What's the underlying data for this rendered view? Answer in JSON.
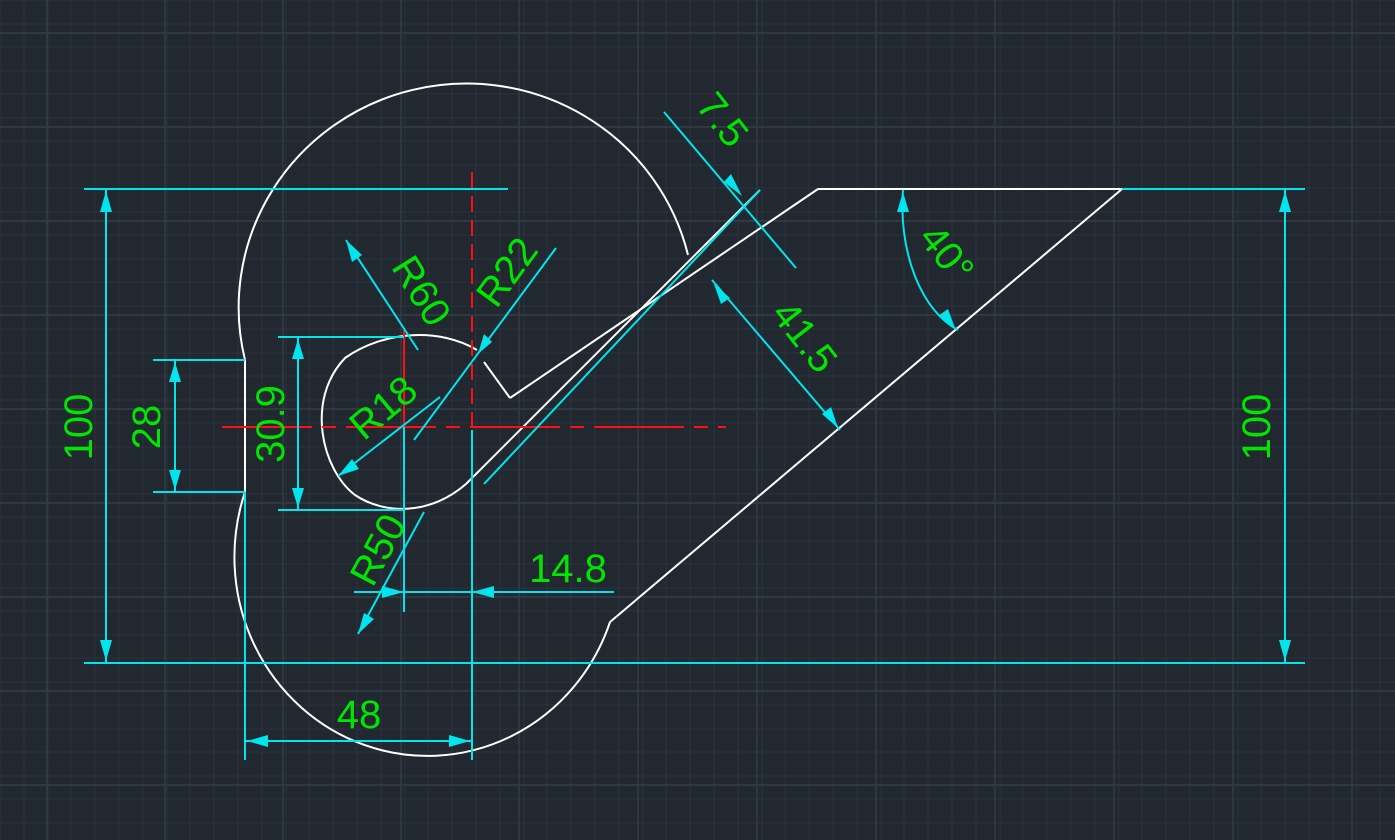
{
  "drawing": {
    "colors": {
      "background": "#212830",
      "geometry": "#ffffff",
      "dimension": "#00e5ee",
      "dimension_text": "#00e600",
      "centerline": "#ff1010"
    },
    "dimensions": {
      "overall_height_left": "100",
      "overall_height_right": "100",
      "flat_height": "28",
      "inner_height": "30.9",
      "base_width": "48",
      "offset": "14.8",
      "slot_width": "7.5",
      "slot_distance": "41.5",
      "angle": "40°",
      "radius_large": "R60",
      "radius_slot": "R22",
      "radius_inner": "R18",
      "radius_lower": "R50"
    }
  }
}
